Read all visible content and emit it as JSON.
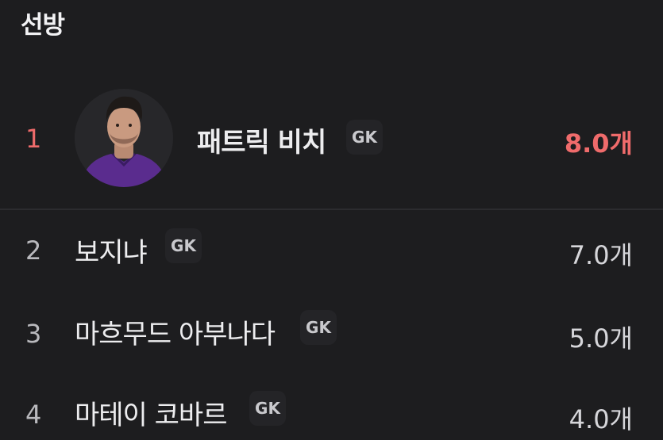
{
  "section": {
    "title": "선방"
  },
  "colors": {
    "background": "#1d1d1f",
    "highlight": "#ef6b6b",
    "badge": "#242427",
    "kit": "#5a2c8e"
  },
  "players": [
    {
      "rank": "1",
      "name": "패트릭 비치",
      "position": "GK",
      "value": "8.0개",
      "has_avatar": true
    },
    {
      "rank": "2",
      "name": "보지냐",
      "position": "GK",
      "value": "7.0개"
    },
    {
      "rank": "3",
      "name": "마흐무드 아부나다",
      "position": "GK",
      "value": "5.0개"
    },
    {
      "rank": "4",
      "name": "마테이 코바르",
      "position": "GK",
      "value": "4.0개"
    }
  ],
  "icons": {
    "avatar": "player-photo-avatar"
  }
}
